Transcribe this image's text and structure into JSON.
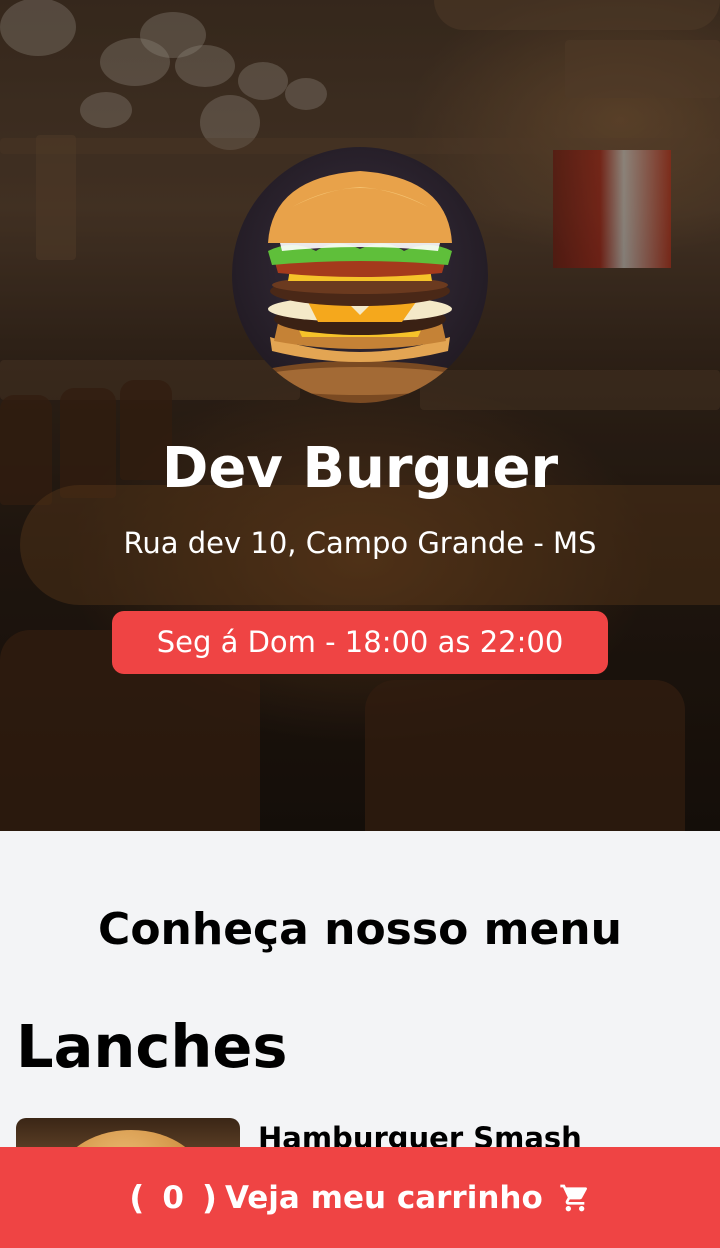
{
  "restaurant": {
    "name": "Dev Burguer",
    "address": "Rua dev 10, Campo Grande - MS",
    "hours": "Seg á Dom - 18:00 as 22:00"
  },
  "menu": {
    "heading": "Conheça nosso menu",
    "categories": [
      {
        "label": "Lanches",
        "items": [
          {
            "name": "Hamburguer Smash"
          }
        ]
      }
    ]
  },
  "cart": {
    "open_paren": "(",
    "count": "0",
    "close_paren": ")",
    "label": "Veja meu carrinho",
    "icon": "cart-icon"
  },
  "colors": {
    "accent": "#ef4444",
    "page_background": "#f3f4f6"
  }
}
